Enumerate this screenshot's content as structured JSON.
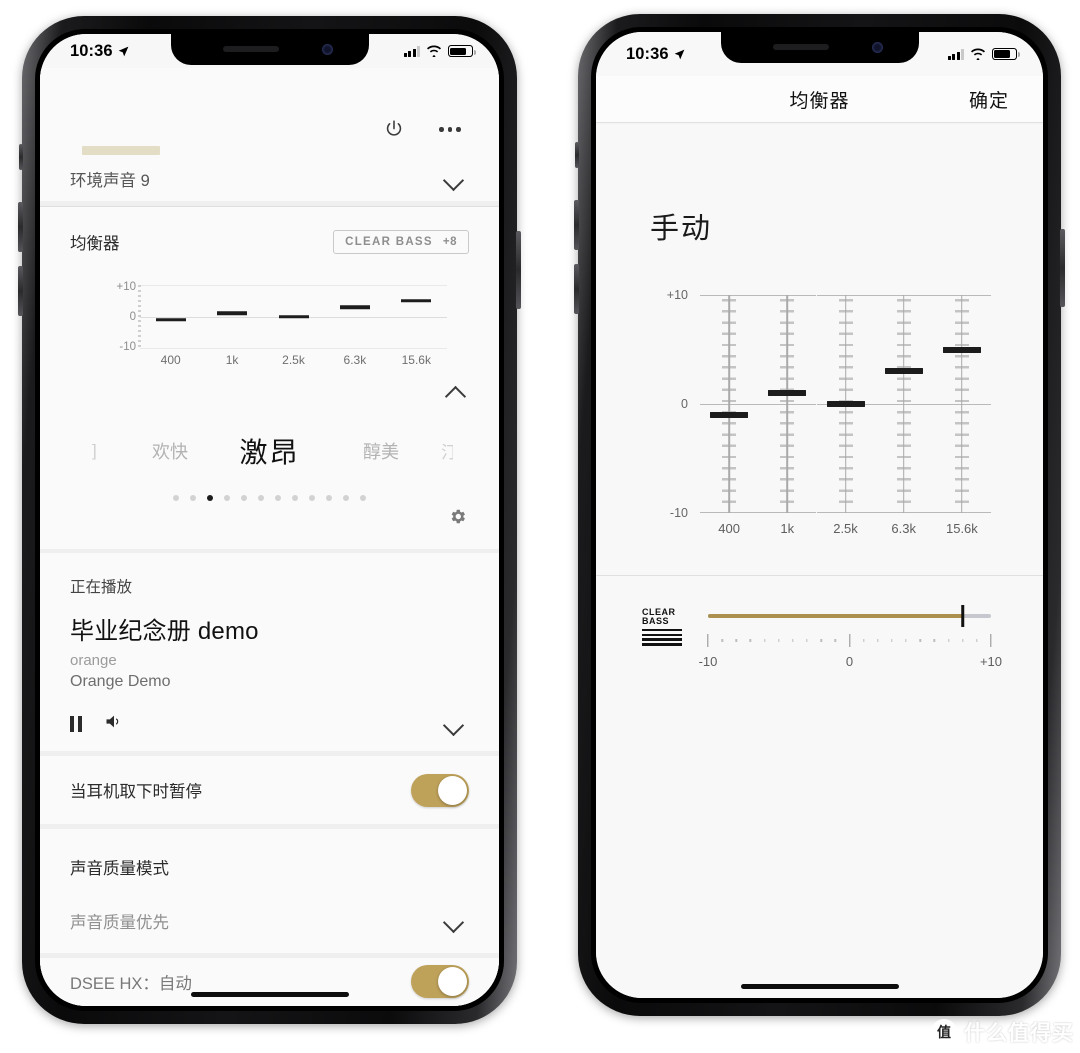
{
  "meta": {
    "accent_gold": "#bfa25a",
    "accent_bass": "#ab9050",
    "bg": "#f7f7f7"
  },
  "status_bar": {
    "time": "10:36",
    "location_icon": "location-arrow-icon"
  },
  "left_phone": {
    "topbar": {
      "power_icon": "power-icon",
      "more_icon": "more-options-icon"
    },
    "ambient": {
      "label": "环境声音 9",
      "chevron": "chevron-down-icon"
    },
    "equalizer": {
      "title": "均衡器",
      "clear_bass_badge": {
        "label": "CLEAR BASS",
        "value": "+8"
      },
      "collapse_chevron": "chevron-up-icon",
      "settings_icon": "gear-icon"
    },
    "presets": {
      "far_left": "]",
      "left": "欢快",
      "current": "激昂",
      "right": "醇美",
      "far_right": "汀",
      "dot_count": 12,
      "active_dot": 3
    },
    "now_playing": {
      "kicker": "正在播放",
      "title": "毕业纪念册 demo",
      "artist": "orange",
      "album": "Orange Demo",
      "pause_icon": "pause-icon",
      "volume_icon": "volume-icon",
      "collapse_chevron": "chevron-down-icon"
    },
    "pause_on_removal": {
      "label": "当耳机取下时暂停",
      "state": "on"
    },
    "sound_quality": {
      "title": "声音质量模式",
      "value": "声音质量优先",
      "chevron": "chevron-down-icon"
    },
    "dsee": {
      "label": "DSEE HX：自动",
      "state": "on"
    }
  },
  "right_phone": {
    "nav": {
      "title": "均衡器",
      "confirm": "确定"
    },
    "preset_name": "手动",
    "clear_bass": {
      "logo_line1": "CLEAR",
      "logo_line2": "BASS",
      "min_label": "-10",
      "mid_label": "0",
      "max_label": "+10",
      "value": 8
    }
  },
  "chart_data": [
    {
      "type": "bar",
      "title": "均衡器",
      "categories": [
        "400",
        "1k",
        "2.5k",
        "6.3k",
        "15.6k"
      ],
      "values": [
        -1,
        1,
        0,
        3,
        5
      ],
      "xlabel": "",
      "ylabel": "",
      "ylim": [
        -10,
        10
      ],
      "ytick_labels": [
        "+10",
        "0",
        "-10"
      ],
      "grid": true,
      "legend": "none",
      "note": "mini equalizer preview on left phone"
    },
    {
      "type": "bar",
      "title": "手动",
      "categories": [
        "400",
        "1k",
        "2.5k",
        "6.3k",
        "15.6k"
      ],
      "values": [
        -1,
        1,
        0,
        3,
        5
      ],
      "xlabel": "",
      "ylabel": "",
      "ylim": [
        -10,
        10
      ],
      "ytick_labels": [
        "+10",
        "0",
        "-10"
      ],
      "grid": true,
      "legend": "none",
      "note": "full equalizer sliders on right phone"
    },
    {
      "type": "bar",
      "title": "CLEAR BASS",
      "categories": [
        "CLEAR BASS"
      ],
      "values": [
        8
      ],
      "xlabel": "",
      "ylabel": "",
      "ylim": [
        -10,
        10
      ],
      "ytick_labels": [
        "-10",
        "0",
        "+10"
      ],
      "grid": false,
      "legend": "none",
      "note": "clear bass horizontal slider, value +8"
    }
  ],
  "watermark": {
    "logo": "值",
    "text": "什么值得买"
  }
}
